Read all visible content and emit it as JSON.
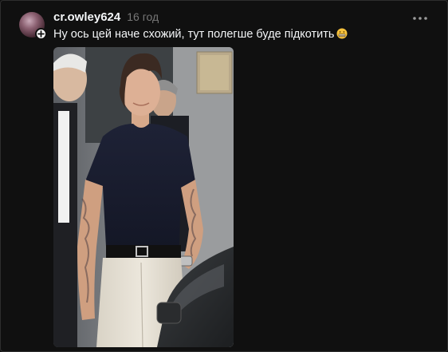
{
  "post": {
    "username": "cr.owley624",
    "timestamp": "16 год",
    "caption": "Ну ось цей наче схожий, тут полегше буде підкотить",
    "caption_emoji": "grimacing-face",
    "avatar_icon": "profile-avatar",
    "follow_icon": "plus-icon",
    "more_icon": "more-horizontal-icon",
    "photo_description_icon": "attached-photo"
  },
  "colors": {
    "background": "#101010",
    "primary_text": "#f3f5f7",
    "secondary_text": "#777777",
    "badge": "#ffffff"
  }
}
